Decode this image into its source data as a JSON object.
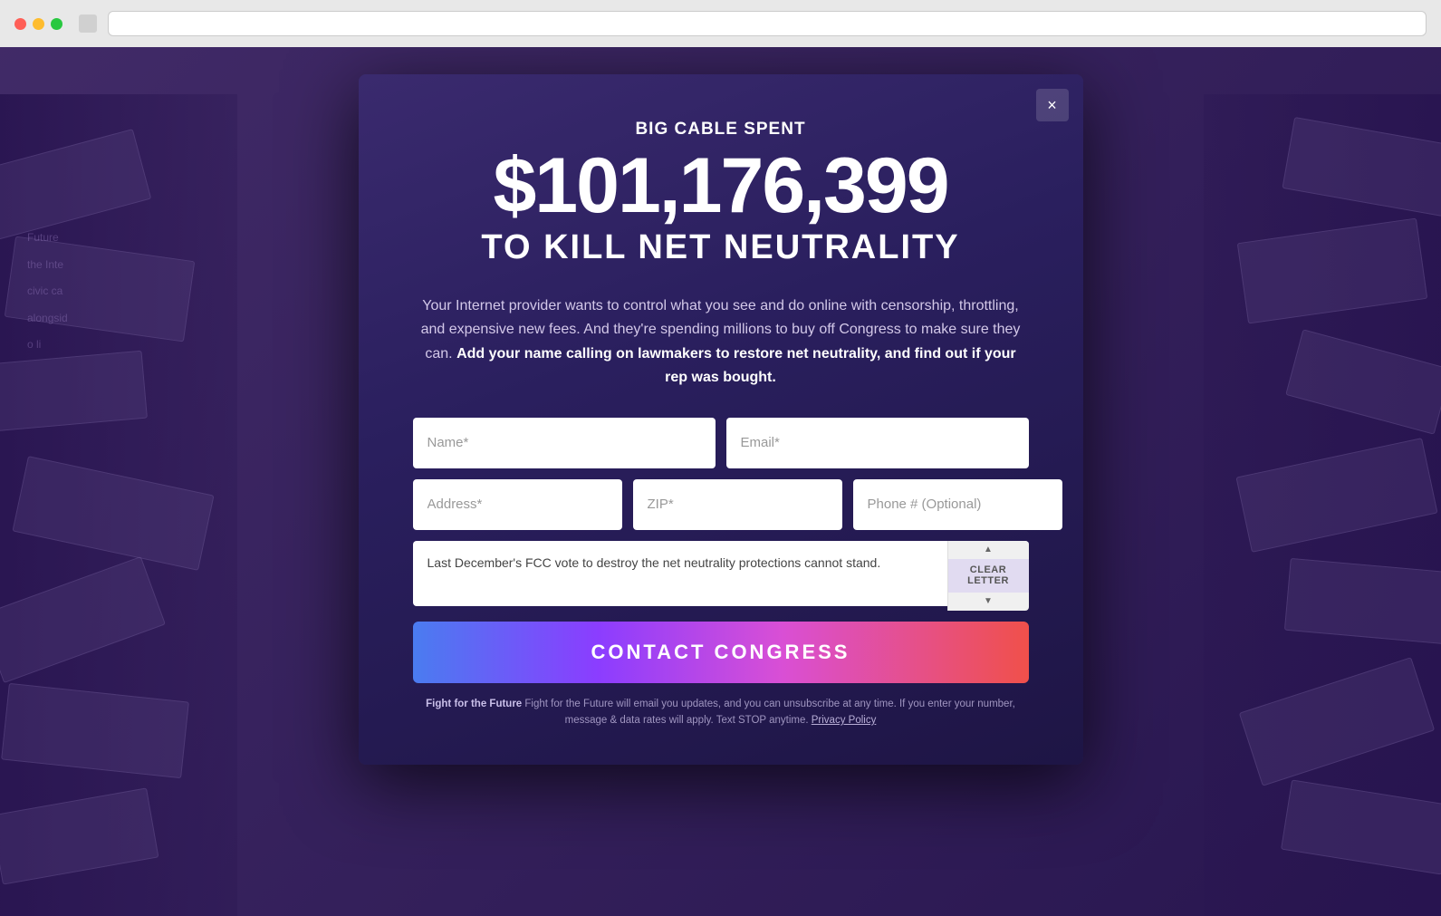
{
  "browser": {
    "traffic_lights": [
      "red",
      "yellow",
      "green"
    ]
  },
  "modal": {
    "close_label": "×",
    "tagline": "BIG CABLE SPENT",
    "big_number": "$101,176,399",
    "subtitle": "TO KILL NET NEUTRALITY",
    "description_plain": "Your Internet provider wants to control what you see and do online with censorship, throttling, and expensive new fees. And they're spending millions to buy off Congress to make sure they can.",
    "description_bold": "Add your name calling on lawmakers to restore net neutrality, and find out if your rep was bought.",
    "form": {
      "name_placeholder": "Name*",
      "email_placeholder": "Email*",
      "address_placeholder": "Address*",
      "zip_placeholder": "ZIP*",
      "phone_placeholder": "Phone # (Optional)",
      "letter_text": "Last December's FCC vote to destroy the net neutrality protections cannot stand.",
      "clear_letter_label": "CLEAR LETTER",
      "contact_button_label": "CONTACT CONGRESS"
    },
    "fine_print_1": "Fight for the Future will email you updates, and you can unsubscribe at any time. If you enter your number, message & data rates will apply. Text STOP anytime.",
    "fine_print_link": "Privacy Policy",
    "fine_print_2": ""
  }
}
